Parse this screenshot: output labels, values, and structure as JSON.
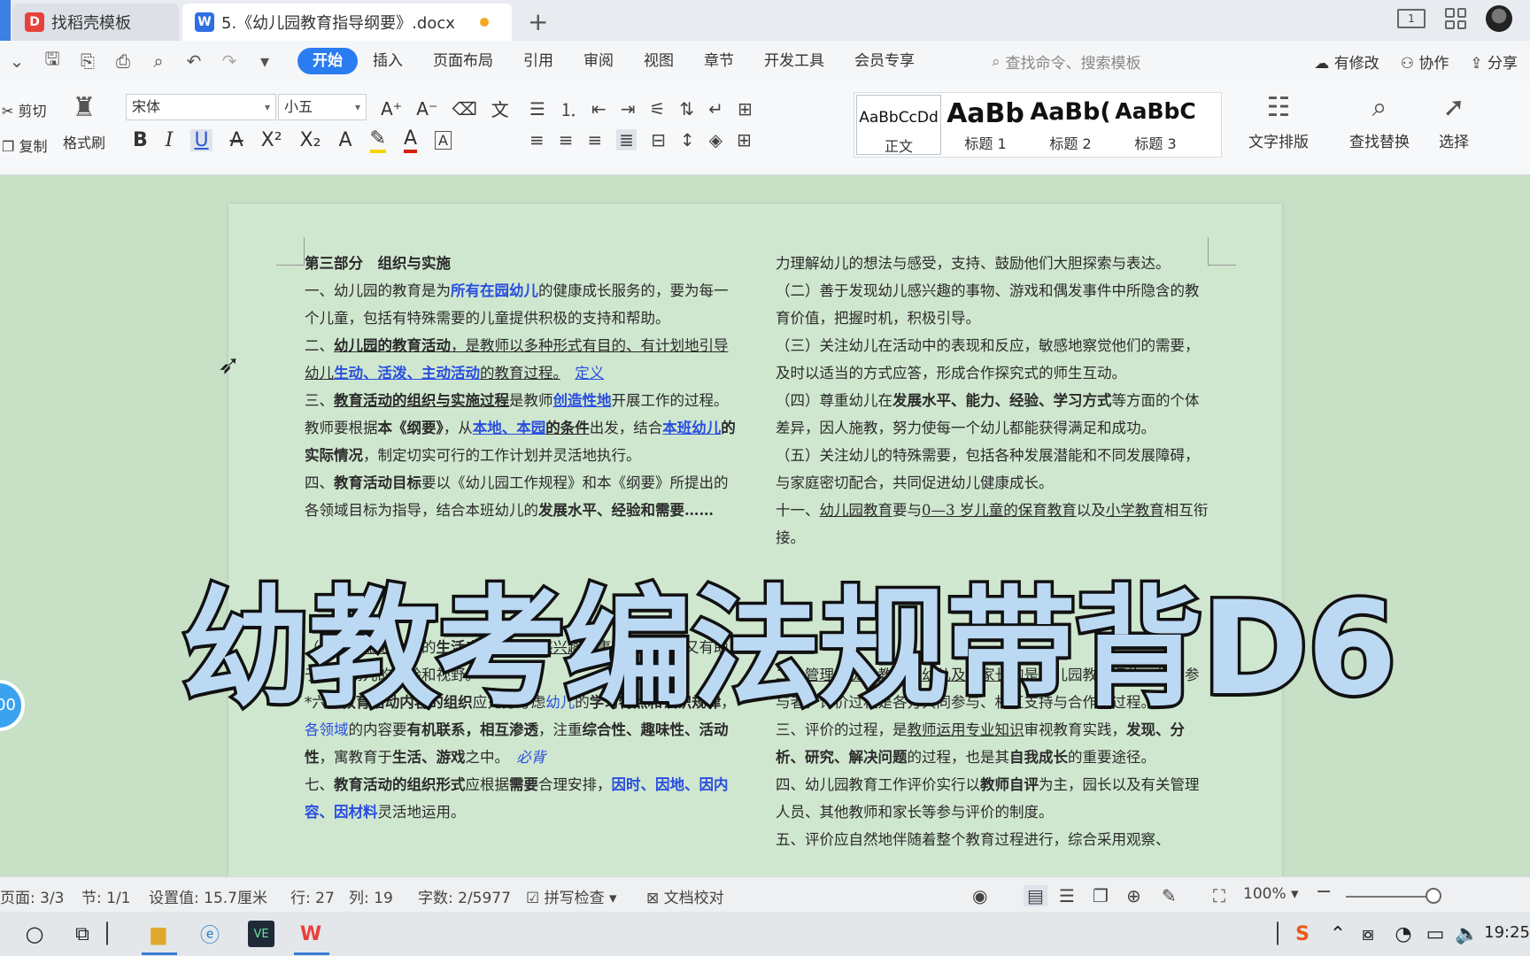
{
  "tabs": [
    {
      "label": "找稻壳模板",
      "icon": "daoke-logo-icon"
    },
    {
      "label": "5.《幼儿园教育指导纲要》.docx",
      "icon": "wps-writer-icon"
    }
  ],
  "ribbon_tabs": [
    "开始",
    "插入",
    "页面布局",
    "引用",
    "审阅",
    "视图",
    "章节",
    "开发工具",
    "会员专享"
  ],
  "active_ribbon_tab": "开始",
  "command_search": {
    "placeholder": "查找命令、搜索模板"
  },
  "top_actions": {
    "revise": "有修改",
    "collab": "协作",
    "share": "分享"
  },
  "clipboard": {
    "cut": "剪切",
    "copy": "复制",
    "format_painter": "格式刷"
  },
  "font": {
    "name": "宋体",
    "size": "小五"
  },
  "styles": [
    {
      "preview": "AaBbCcDd",
      "label": "正文"
    },
    {
      "preview": "AaBb",
      "label": "标题 1"
    },
    {
      "preview": "AaBb(",
      "label": "标题 2"
    },
    {
      "preview": "AaBbC",
      "label": "标题 3"
    }
  ],
  "tools": {
    "text_layout": "文字排版",
    "find_replace": "查找替换",
    "select": "选择"
  },
  "document": {
    "left": {
      "heading": "第三部分　组织与实施",
      "p1_a": "一、幼儿园的教育是为",
      "p1_b": "所有在园幼儿",
      "p1_c": "的健康成长服务的，要为每一个儿童，包括有特殊需要的儿童提供积极的支持和帮助。",
      "p2_a": "二、",
      "p2_b": "幼儿园的教育活动",
      "p2_c": "，是教师以多种形式有目的、有计划地引导幼儿",
      "p2_d": "生动、活泼、主动活动",
      "p2_e": "的教育过程。",
      "p2_f": "定义",
      "p3_a": "三、",
      "p3_b": "教育活动的组织与实施过程",
      "p3_c": "是教师",
      "p3_d": "创造性地",
      "p3_e": "开展工作的过程。教师要根据",
      "p3_f": "本《纲要》",
      "p3_g": "，从",
      "p3_h": "本地、本园",
      "p3_i": "的条件",
      "p3_j": "出发，结合",
      "p3_k": "本班幼儿",
      "p3_l": "的实际情况",
      "p3_m": "，制定切实可行的工作计划并灵活地执行。",
      "p4_a": "四、",
      "p4_b": "教育活动目标",
      "p4_c": "要以《幼儿园工作规程》和本《纲要》所提出的各领域目标为指导，结合本班幼儿的",
      "p4_d": "发展水平、经验和",
      "p4_e": "需要……",
      "p5_c": "（三）既",
      "p5_d": "贴近",
      "p5_e": "幼儿的",
      "p5_f": "生活",
      "p5_g": "来选择幼儿",
      "p5_h": "感兴趣",
      "p5_i": "的事物和问题，又有助于",
      "p5_j": "拓展",
      "p5_k": "幼儿的经验和视野。",
      "p6_a": "*六、",
      "p6_b": "教育活动内容的组织",
      "p6_c": "应充分考虑",
      "p6_d": "幼儿",
      "p6_e": "的",
      "p6_f": "学习特点和认识规律",
      "p6_g": "，",
      "p6_h": "各领域",
      "p6_i": "的内容要",
      "p6_j": "有机联系，相互渗透",
      "p6_k": "，注重",
      "p6_l": "综合性、趣味性、活动性",
      "p6_m": "，寓教育于",
      "p6_n": "生活、游戏",
      "p6_o": "之中。",
      "p6_p": "必背",
      "p7_a": "七、",
      "p7_b": "教育活动的组织形式",
      "p7_c": "应根据",
      "p7_d": "需要",
      "p7_e": "合理安排，",
      "p7_f": "因时、因地、因内容、因材料",
      "p7_g": "灵活地运用。"
    },
    "right": {
      "r0": "力理解幼儿的想法与感受，支持、鼓励他们大胆探索与表达。",
      "r1": "（二）善于发现幼儿感兴趣的事物、游戏和偶发事件中所隐含的教育价值，把握时机，积极引导。",
      "r2": "（三）关注幼儿在活动中的表现和反应，敏感地察觉他们的需要，及时以适当的方式应答，形成合作探究式的师生互动。",
      "r3_a": "（四）尊重幼儿在",
      "r3_b": "发展水平、能力、经验、学习方式",
      "r3_c": "等方面的个体差异，因人施教，努力使每一个幼儿都能获得满足和成功。",
      "r4": "（五）关注幼儿的特殊需要，包括各种发展潜能和不同发展障碍，与家庭密切配合，共同促进幼儿健康成长。",
      "r5_a": "十一、",
      "r5_b": "幼儿园教育",
      "r5_c": "要与",
      "r5_d": "0—3 岁儿童的保育教育",
      "r5_e": "以及",
      "r5_f": "小学教育",
      "r5_g": "相互衔接。",
      "r6_a": "二、",
      "r6_b": "管理人员、教师、幼儿及其家长",
      "r6_c": "均是幼儿园教育评价工作的参与者。评价过程是各方共同参与、相互支持与合作的过程。",
      "r7_a": "三、评价的过程，是",
      "r7_b": "教师运用专业知识",
      "r7_c": "审视教育实践，",
      "r7_d": "发现、分析、研究、解决问题",
      "r7_e": "的过程，也是其",
      "r7_f": "自我成长",
      "r7_g": "的重要途径。",
      "r8_a": "四、幼儿园教育工作评价实行以",
      "r8_b": "教师自评",
      "r8_c": "为主，园长以及有关管理人员、其他教师和家长等参与评价的制度。",
      "r9": "五、评价应自然地伴随着整个教育过程进行，综合采用观察、"
    }
  },
  "overlay_title": "幼教考编法规带背D6",
  "status": {
    "page": "页面: 3/3",
    "section": "节: 1/1",
    "position": "设置值: 15.7厘米",
    "row": "行: 27",
    "column": "列: 19",
    "word_count": "字数: 2/5977",
    "spell_check": "拼写检查",
    "doc_check": "文档校对",
    "zoom": "100%"
  },
  "taskbar": {
    "clock": "19:25"
  },
  "colors": {
    "accent": "#2a7cf0",
    "page_bg": "#cfe7cf",
    "link_blue": "#2a4ee0"
  }
}
